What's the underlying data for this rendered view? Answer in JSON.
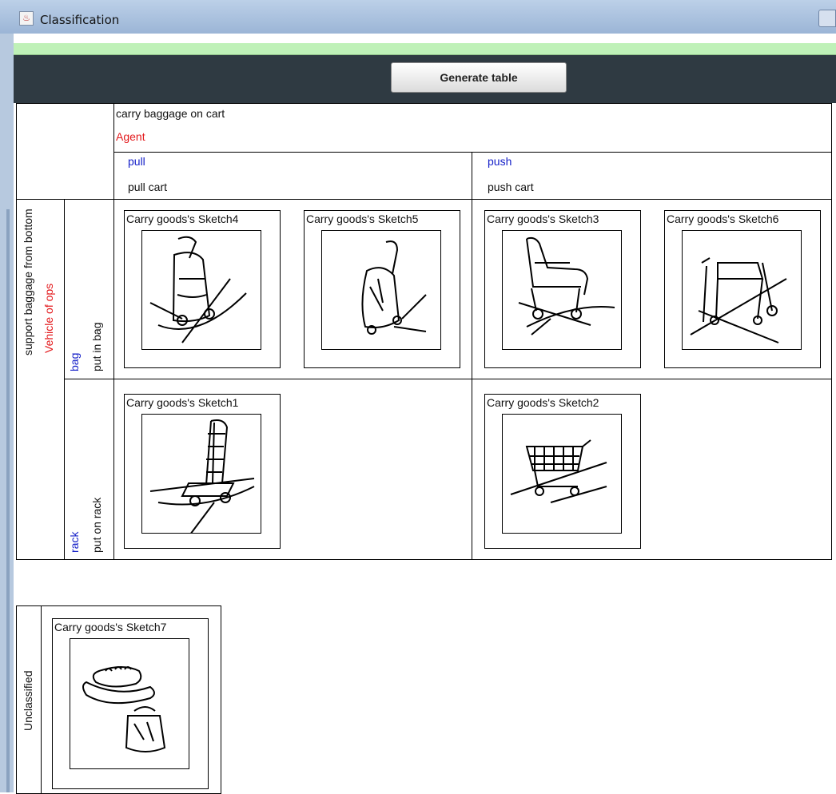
{
  "window": {
    "title": "Classification"
  },
  "toolbar": {
    "generate_label": "Generate table"
  },
  "table": {
    "top_header": {
      "title": "carry baggage on cart",
      "agent": "Agent"
    },
    "columns": [
      {
        "tag": "pull",
        "label": "pull cart"
      },
      {
        "tag": "push",
        "label": "push cart"
      }
    ],
    "side_header": {
      "outer": "support baggage from bottom",
      "vehicle": "Vehicle of ops"
    },
    "rows": [
      {
        "tag": "bag",
        "label": "put in bag"
      },
      {
        "tag": "rack",
        "label": "put on rack"
      }
    ],
    "sketches": [
      {
        "title": "Carry goods's Sketch4",
        "icon": "bag-cart-sketch"
      },
      {
        "title": "Carry goods's Sketch5",
        "icon": "bag-cart-sketch"
      },
      {
        "title": "Carry goods's Sketch3",
        "icon": "wheelchair-cart-sketch"
      },
      {
        "title": "Carry goods's Sketch6",
        "icon": "walker-cart-sketch"
      },
      {
        "title": "Carry goods's Sketch1",
        "icon": "rack-trolley-sketch"
      },
      {
        "title": "Carry goods's Sketch2",
        "icon": "shopping-cart-sketch"
      }
    ]
  },
  "unclassified": {
    "label": "Unclassified",
    "sketch": {
      "title": "Carry goods's Sketch7",
      "icon": "bag-items-sketch"
    }
  },
  "colors": {
    "toolbar_bg": "#2f3a42",
    "green_bar": "#bff1b8",
    "agent_red": "#e3191c",
    "tag_blue": "#1520c8"
  }
}
